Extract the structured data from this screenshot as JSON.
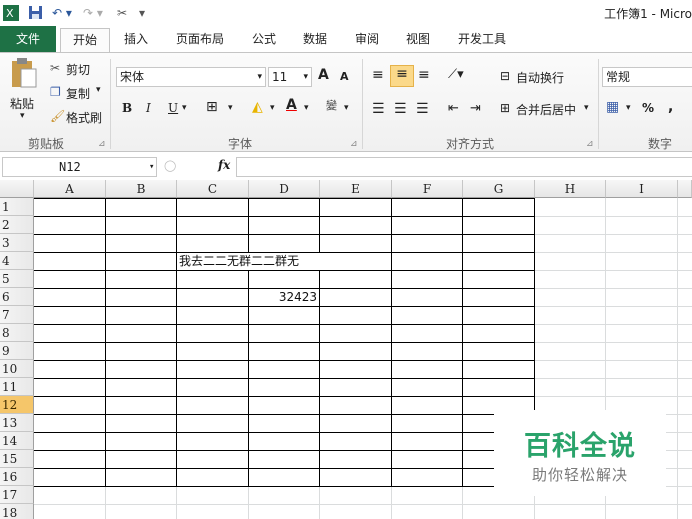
{
  "title_bar": {
    "title": "工作簿1 - Micro"
  },
  "tabs": [
    "文件",
    "开始",
    "插入",
    "页面布局",
    "公式",
    "数据",
    "审阅",
    "视图",
    "开发工具"
  ],
  "clipboard": {
    "paste": "粘贴",
    "cut": "剪切",
    "copy": "复制",
    "format_painter": "格式刷",
    "group": "剪贴板"
  },
  "font": {
    "name": "宋体",
    "size": "11",
    "bold": "B",
    "italic": "I",
    "underline": "U",
    "group": "字体",
    "grow": "A",
    "shrink": "A",
    "wen": "wén\n变"
  },
  "alignment": {
    "wrap": "自动换行",
    "merge": "合并后居中",
    "group": "对齐方式"
  },
  "number": {
    "format": "常规",
    "percent": "%",
    "comma": ",",
    "group": "数字"
  },
  "formula_bar": {
    "name_box": "N12",
    "fx": "fx"
  },
  "columns": [
    "A",
    "B",
    "C",
    "D",
    "E",
    "F",
    "G",
    "H",
    "I"
  ],
  "rows": [
    "1",
    "2",
    "3",
    "4",
    "5",
    "6",
    "7",
    "8",
    "9",
    "10",
    "11",
    "12",
    "13",
    "14",
    "15",
    "16",
    "17",
    "18"
  ],
  "cells": {
    "C4": "我去二二无群二二群无",
    "D6": "32423"
  },
  "watermark": {
    "title": "百科全说",
    "subtitle": "助你轻松解决"
  },
  "colors": {
    "file_tab": "#1e7145",
    "selected_row_header": "#f5c66a",
    "watermark_green": "#2aa36b"
  }
}
